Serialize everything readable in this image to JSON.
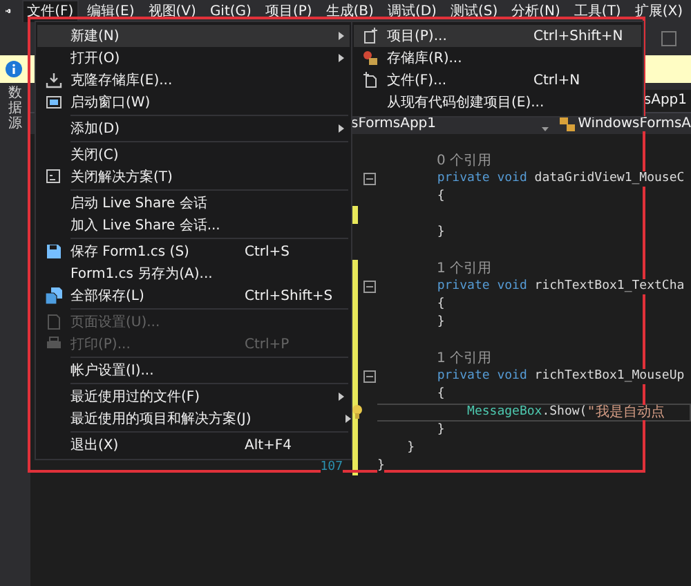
{
  "menu_bar": [
    {
      "label": "文件(F)",
      "selected": true
    },
    {
      "label": "编辑(E)",
      "selected": false
    },
    {
      "label": "视图(V)",
      "selected": false
    },
    {
      "label": "Git(G)",
      "selected": false
    },
    {
      "label": "项目(P)",
      "selected": false
    },
    {
      "label": "生成(B)",
      "selected": false
    },
    {
      "label": "调试(D)",
      "selected": false
    },
    {
      "label": "测试(S)",
      "selected": false
    },
    {
      "label": "分析(N)",
      "selected": false
    },
    {
      "label": "工具(T)",
      "selected": false
    },
    {
      "label": "扩展(X)",
      "selected": false
    }
  ],
  "side_tab": {
    "label": "数据源"
  },
  "editor": {
    "tab": "sApp1",
    "nav_project": "sFormsApp1",
    "nav_class": "WindowsFormsA",
    "lines": [
      {
        "kind": "blank",
        "changed": false
      },
      {
        "kind": "refs",
        "text": "0 个引用",
        "changed": false
      },
      {
        "kind": "code",
        "fold": true,
        "changed": false,
        "segments": [
          {
            "kind": "keyword",
            "text": "        private void "
          },
          {
            "kind": "plain",
            "text": "dataGridView1_MouseC"
          }
        ]
      },
      {
        "kind": "code",
        "fold": false,
        "changed": false,
        "segments": [
          {
            "kind": "plain",
            "text": "        {"
          }
        ]
      },
      {
        "kind": "blank",
        "changed": true
      },
      {
        "kind": "code",
        "fold": false,
        "changed": false,
        "segments": [
          {
            "kind": "plain",
            "text": "        }"
          }
        ]
      },
      {
        "kind": "blank",
        "changed": false
      },
      {
        "kind": "refs",
        "text": "1 个引用",
        "changed": true
      },
      {
        "kind": "code",
        "fold": true,
        "changed": true,
        "segments": [
          {
            "kind": "keyword",
            "text": "        private void "
          },
          {
            "kind": "plain",
            "text": "richTextBox1_TextCha"
          }
        ]
      },
      {
        "kind": "code",
        "fold": false,
        "changed": true,
        "segments": [
          {
            "kind": "plain",
            "text": "        {"
          }
        ]
      },
      {
        "kind": "code",
        "fold": false,
        "changed": true,
        "segments": [
          {
            "kind": "plain",
            "text": "        }"
          }
        ]
      },
      {
        "kind": "blank",
        "changed": true
      },
      {
        "kind": "refs",
        "text": "1 个引用",
        "changed": true
      },
      {
        "kind": "code",
        "fold": true,
        "changed": true,
        "segments": [
          {
            "kind": "keyword",
            "text": "        private void "
          },
          {
            "kind": "plain",
            "text": "richTextBox1_MouseUp"
          }
        ]
      },
      {
        "kind": "code",
        "fold": false,
        "changed": true,
        "segments": [
          {
            "kind": "plain",
            "text": "        {"
          }
        ]
      },
      {
        "kind": "code",
        "fold": false,
        "changed": true,
        "current": true,
        "hint": true,
        "segments": [
          {
            "kind": "type",
            "text": "            MessageBox"
          },
          {
            "kind": "plain",
            "text": ".Show("
          },
          {
            "kind": "string",
            "text": "\"我是自动点"
          }
        ]
      },
      {
        "kind": "code",
        "fold": false,
        "changed": true,
        "segments": [
          {
            "kind": "plain",
            "text": "        }"
          }
        ]
      },
      {
        "kind": "code",
        "fold": false,
        "changed": true,
        "segments": [
          {
            "kind": "plain",
            "text": "    }"
          }
        ]
      },
      {
        "kind": "code",
        "fold": false,
        "changed": true,
        "number": "107",
        "segments": [
          {
            "kind": "plain",
            "text": "}"
          }
        ]
      }
    ]
  },
  "file_menu": {
    "sections": [
      [
        {
          "label": "新建(N)",
          "submenu": true,
          "selected": true,
          "disabled": false
        },
        {
          "label": "打开(O)",
          "submenu": true,
          "selected": false,
          "disabled": false
        },
        {
          "label": "克隆存储库(E)...",
          "submenu": false,
          "selected": false,
          "disabled": false
        },
        {
          "label": "启动窗口(W)",
          "submenu": false,
          "selected": false,
          "disabled": false
        }
      ],
      [
        {
          "label": "添加(D)",
          "submenu": true,
          "selected": false,
          "disabled": false
        }
      ],
      [
        {
          "label": "关闭(C)",
          "submenu": false,
          "selected": false,
          "disabled": false
        },
        {
          "label": "关闭解决方案(T)",
          "submenu": false,
          "selected": false,
          "disabled": false
        }
      ],
      [
        {
          "label": "启动 Live Share 会话",
          "submenu": false,
          "selected": false,
          "disabled": false
        },
        {
          "label": "加入 Live Share 会话...",
          "submenu": false,
          "selected": false,
          "disabled": false
        }
      ],
      [
        {
          "label": "保存 Form1.cs (S)",
          "shortcut": "Ctrl+S",
          "submenu": false,
          "selected": false,
          "disabled": false
        },
        {
          "label": "Form1.cs 另存为(A)...",
          "submenu": false,
          "selected": false,
          "disabled": false
        },
        {
          "label": "全部保存(L)",
          "shortcut": "Ctrl+Shift+S",
          "submenu": false,
          "selected": false,
          "disabled": false
        }
      ],
      [
        {
          "label": "页面设置(U)...",
          "submenu": false,
          "selected": false,
          "disabled": true
        },
        {
          "label": "打印(P)...",
          "shortcut": "Ctrl+P",
          "submenu": false,
          "selected": false,
          "disabled": true
        }
      ],
      [
        {
          "label": "帐户设置(I)...",
          "submenu": false,
          "selected": false,
          "disabled": false
        }
      ],
      [
        {
          "label": "最近使用过的文件(F)",
          "submenu": true,
          "selected": false,
          "disabled": false
        },
        {
          "label": "最近使用的项目和解决方案(J)",
          "submenu": true,
          "selected": false,
          "disabled": false
        }
      ],
      [
        {
          "label": "退出(X)",
          "shortcut": "Alt+F4",
          "submenu": false,
          "selected": false,
          "disabled": false
        }
      ]
    ]
  },
  "new_submenu": {
    "items": [
      {
        "label": "项目(P)...",
        "shortcut": "Ctrl+Shift+N",
        "selected": true
      },
      {
        "label": "存储库(R)...",
        "selected": false
      },
      {
        "label": "文件(F)...",
        "shortcut": "Ctrl+N",
        "selected": false
      },
      {
        "label": "从现有代码创建项目(E)...",
        "selected": false
      }
    ]
  }
}
